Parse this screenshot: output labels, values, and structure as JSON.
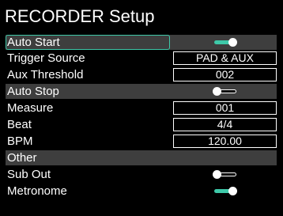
{
  "title": "RECORDER Setup",
  "rows": {
    "auto_start": {
      "label": "Auto Start",
      "toggle": "on"
    },
    "trigger_source": {
      "label": "Trigger Source",
      "value": "PAD & AUX"
    },
    "aux_threshold": {
      "label": "Aux Threshold",
      "value": "002"
    },
    "auto_stop": {
      "label": "Auto Stop",
      "toggle": "off"
    },
    "measure": {
      "label": "Measure",
      "value": "001"
    },
    "beat": {
      "label": "Beat",
      "value": "4/4"
    },
    "bpm": {
      "label": "BPM",
      "value": "120.00"
    },
    "other": {
      "label": "Other"
    },
    "sub_out": {
      "label": "Sub Out",
      "toggle": "off"
    },
    "metronome": {
      "label": "Metronome",
      "toggle": "on"
    }
  },
  "colors": {
    "accent": "#3ec9a9",
    "section_bg": "#3e3e3e",
    "background": "#000000"
  }
}
